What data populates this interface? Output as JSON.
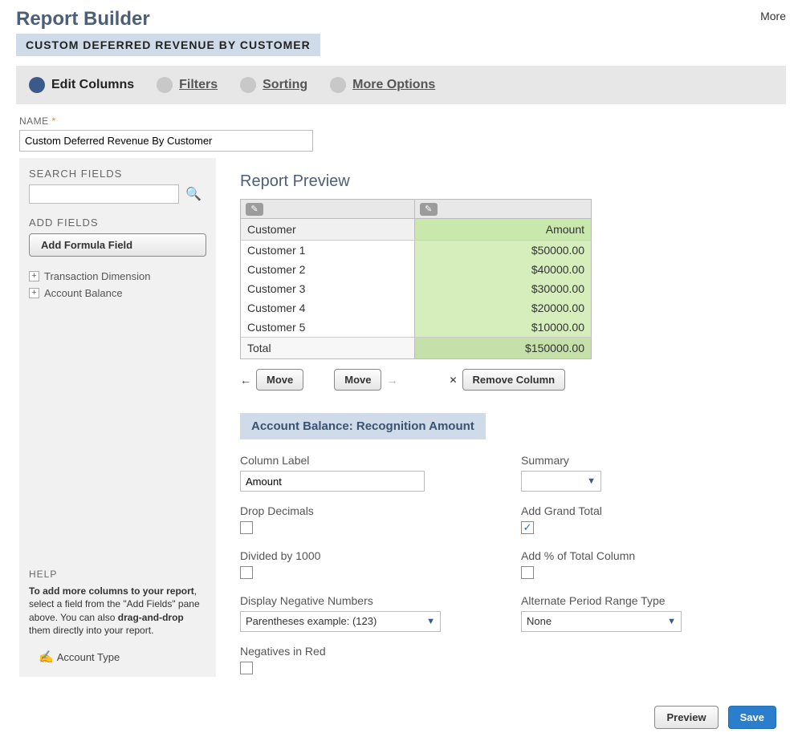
{
  "header": {
    "title": "Report Builder",
    "subtitle": "CUSTOM DEFERRED REVENUE BY CUSTOMER",
    "more": "More"
  },
  "steps": {
    "edit_columns": "Edit Columns",
    "filters": "Filters",
    "sorting": "Sorting",
    "more_options": "More Options"
  },
  "name_field": {
    "label": "NAME",
    "value": "Custom Deferred Revenue By Customer"
  },
  "left": {
    "search_heading": "SEARCH FIELDS",
    "add_fields_heading": "ADD FIELDS",
    "add_formula_button": "Add Formula Field",
    "tree": [
      "Transaction Dimension",
      "Account Balance"
    ],
    "help_title": "HELP",
    "help_text_1a": "To add more columns to your report",
    "help_text_1b": ", select a field from the \"Add Fields\" pane above. You can also ",
    "help_text_1c": "drag-and-drop",
    "help_text_1d": " them directly into your report.",
    "drag_sample": "Account Type"
  },
  "preview": {
    "title": "Report Preview",
    "columns": {
      "c1": "Customer",
      "c2": "Amount"
    },
    "rows": [
      {
        "c1": "Customer 1",
        "c2": "$50000.00"
      },
      {
        "c1": "Customer 2",
        "c2": "$40000.00"
      },
      {
        "c1": "Customer 3",
        "c2": "$30000.00"
      },
      {
        "c1": "Customer 4",
        "c2": "$20000.00"
      },
      {
        "c1": "Customer 5",
        "c2": "$10000.00"
      }
    ],
    "total_label": "Total",
    "total_value": "$150000.00",
    "move_label": "Move",
    "remove_label": "Remove Column"
  },
  "column_config": {
    "title": "Account Balance: Recognition Amount",
    "column_label": {
      "label": "Column Label",
      "value": "Amount"
    },
    "summary": {
      "label": "Summary",
      "value": ""
    },
    "drop_decimals": {
      "label": "Drop Decimals",
      "checked": false
    },
    "add_grand_total": {
      "label": "Add Grand Total",
      "checked": true
    },
    "divided_by_1000": {
      "label": "Divided by 1000",
      "checked": false
    },
    "add_pct_total": {
      "label": "Add % of Total Column",
      "checked": false
    },
    "display_negative": {
      "label": "Display Negative Numbers",
      "value": "Parentheses  example: (123)"
    },
    "alternate_period": {
      "label": "Alternate Period Range Type",
      "value": "None"
    },
    "negatives_in_red": {
      "label": "Negatives in Red",
      "checked": false
    }
  },
  "footer": {
    "preview": "Preview",
    "save": "Save"
  }
}
